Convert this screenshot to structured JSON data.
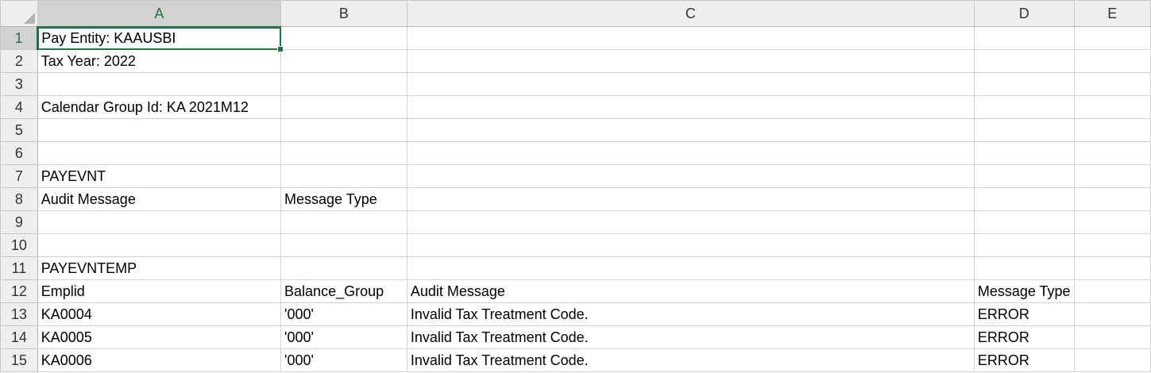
{
  "sheet": {
    "columns": [
      "A",
      "B",
      "C",
      "D",
      "E"
    ],
    "active_cell": "A1",
    "rows": [
      {
        "num": "1",
        "cells": [
          "Pay Entity: KAAUSBI",
          "",
          "",
          "",
          ""
        ]
      },
      {
        "num": "2",
        "cells": [
          "Tax Year: 2022",
          "",
          "",
          "",
          ""
        ]
      },
      {
        "num": "3",
        "cells": [
          "",
          "",
          "",
          "",
          ""
        ]
      },
      {
        "num": "4",
        "cells": [
          "Calendar Group Id: KA 2021M12",
          "",
          "",
          "",
          ""
        ]
      },
      {
        "num": "5",
        "cells": [
          "",
          "",
          "",
          "",
          ""
        ]
      },
      {
        "num": "6",
        "cells": [
          "",
          "",
          "",
          "",
          ""
        ]
      },
      {
        "num": "7",
        "cells": [
          "PAYEVNT",
          "",
          "",
          "",
          ""
        ]
      },
      {
        "num": "8",
        "cells": [
          "Audit Message",
          "Message Type",
          "",
          "",
          ""
        ]
      },
      {
        "num": "9",
        "cells": [
          "",
          "",
          "",
          "",
          ""
        ]
      },
      {
        "num": "10",
        "cells": [
          "",
          "",
          "",
          "",
          ""
        ]
      },
      {
        "num": "11",
        "cells": [
          "PAYEVNTEMP",
          "",
          "",
          "",
          ""
        ]
      },
      {
        "num": "12",
        "cells": [
          "Emplid",
          "Balance_Group",
          "Audit Message",
          "Message Type",
          ""
        ]
      },
      {
        "num": "13",
        "cells": [
          "KA0004",
          "'000'",
          "Invalid Tax Treatment Code.",
          "ERROR",
          ""
        ]
      },
      {
        "num": "14",
        "cells": [
          "KA0005",
          "'000'",
          "Invalid Tax Treatment Code.",
          "ERROR",
          ""
        ]
      },
      {
        "num": "15",
        "cells": [
          "KA0006",
          "'000'",
          "Invalid Tax Treatment Code.",
          "ERROR",
          ""
        ]
      }
    ]
  },
  "colors": {
    "accent": "#217346",
    "header_bg": "#efefef",
    "header_active_bg": "#d2d2d2",
    "gridline": "#d4d4d4"
  }
}
